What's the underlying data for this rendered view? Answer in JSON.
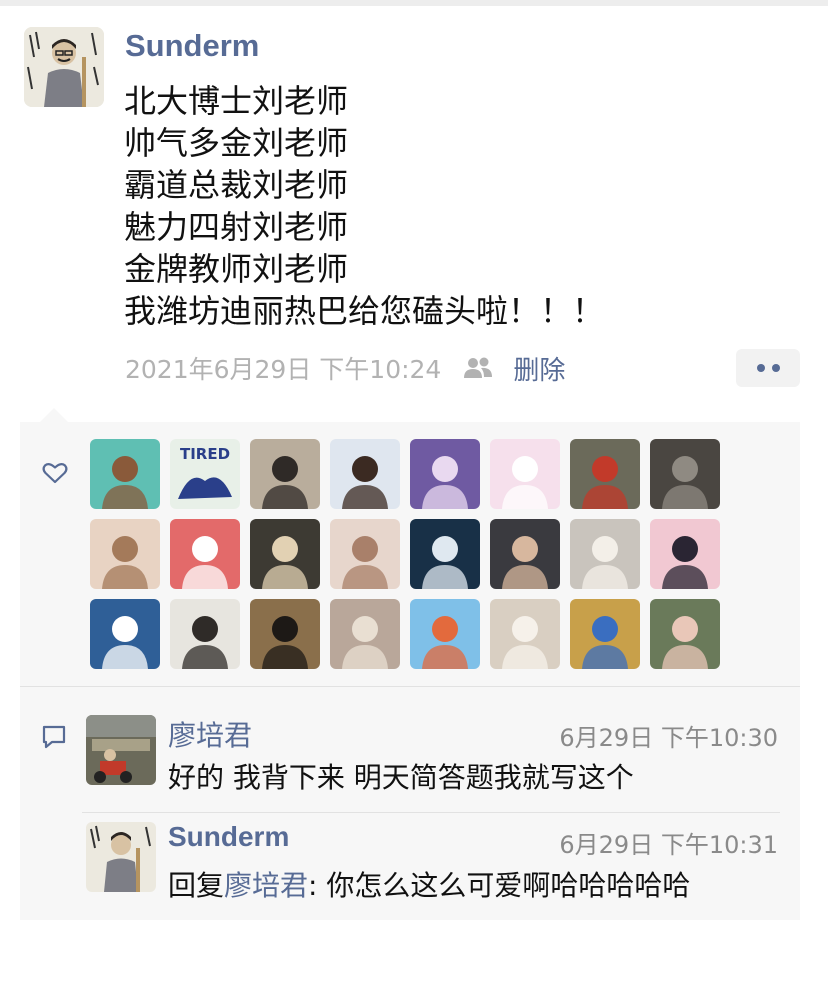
{
  "post": {
    "author": "Sunderm",
    "lines": [
      "北大博士刘老师",
      "帅气多金刘老师",
      "霸道总裁刘老师",
      "魅力四射刘老师",
      "金牌教师刘老师",
      "我潍坊迪丽热巴给您磕头啦！！！"
    ],
    "time": "2021年6月29日 下午10:24",
    "visibility_icon": "friends-icon",
    "delete_label": "删除",
    "more_icon": "more-dots-icon"
  },
  "likes": {
    "icon": "heart-icon",
    "avatars": [
      {
        "name": "cartoon-girl",
        "bg": "#5fbfb3",
        "fg": "#8a5a3a"
      },
      {
        "name": "tired-text",
        "bg": "#e8f0e8",
        "fg": "#2a3f8a",
        "label": "TIRED"
      },
      {
        "name": "street-woman",
        "bg": "#b9ad9c",
        "fg": "#2f2a27"
      },
      {
        "name": "boy-portrait",
        "bg": "#dfe6ef",
        "fg": "#3b2a22"
      },
      {
        "name": "anime-purple",
        "bg": "#6f5aa2",
        "fg": "#e9d9f0"
      },
      {
        "name": "pink-bunny",
        "bg": "#f6e0ec",
        "fg": "#ffffff"
      },
      {
        "name": "scooter-street",
        "bg": "#6b6a5a",
        "fg": "#c23a2a"
      },
      {
        "name": "dark-figure",
        "bg": "#4a4641",
        "fg": "#8f8a82"
      },
      {
        "name": "girl-hat",
        "bg": "#e8d3c3",
        "fg": "#a47a5a"
      },
      {
        "name": "hello-kitty",
        "bg": "#e36a6a",
        "fg": "#ffffff"
      },
      {
        "name": "blonde-girl",
        "bg": "#3d3a33",
        "fg": "#e2d1b3"
      },
      {
        "name": "girl-cat",
        "bg": "#e7d6cc",
        "fg": "#a9806a"
      },
      {
        "name": "astronaut",
        "bg": "#183047",
        "fg": "#dfe8f0"
      },
      {
        "name": "smiling-man",
        "bg": "#3a3a3f",
        "fg": "#d7b79e"
      },
      {
        "name": "sleeping-dog",
        "bg": "#c9c4bd",
        "fg": "#f3efe8"
      },
      {
        "name": "black-cat",
        "bg": "#f1c8d2",
        "fg": "#2a2533"
      },
      {
        "name": "white-goose",
        "bg": "#2f5f97",
        "fg": "#ffffff"
      },
      {
        "name": "snow-man",
        "bg": "#e7e5df",
        "fg": "#2f2b28"
      },
      {
        "name": "film-woman",
        "bg": "#8a6f4b",
        "fg": "#1d1916"
      },
      {
        "name": "man-blonde",
        "bg": "#b9a79a",
        "fg": "#e9dfd2"
      },
      {
        "name": "anime-red-hair",
        "bg": "#7fc0e8",
        "fg": "#e36a3d"
      },
      {
        "name": "fluffy-bear",
        "bg": "#d9cfc2",
        "fg": "#f6f1ea"
      },
      {
        "name": "colorful-room",
        "bg": "#c8a04a",
        "fg": "#3a6ec0"
      },
      {
        "name": "flower-tree",
        "bg": "#6a7a5a",
        "fg": "#e9c7b8"
      }
    ]
  },
  "comments": {
    "icon": "comment-icon",
    "items": [
      {
        "name": "廖培君",
        "time": "6月29日 下午10:30",
        "text": "好的 我背下来 明天简答题我就写这个"
      },
      {
        "name": "Sunderm",
        "time": "6月29日 下午10:31",
        "reply_prefix": "回复",
        "reply_to": "廖培君",
        "text": ": 你怎么这么可爱啊哈哈哈哈哈"
      }
    ]
  },
  "colors": {
    "link": "#576b95",
    "panel": "#f7f7f7",
    "meta_text": "#b2b2b2"
  }
}
